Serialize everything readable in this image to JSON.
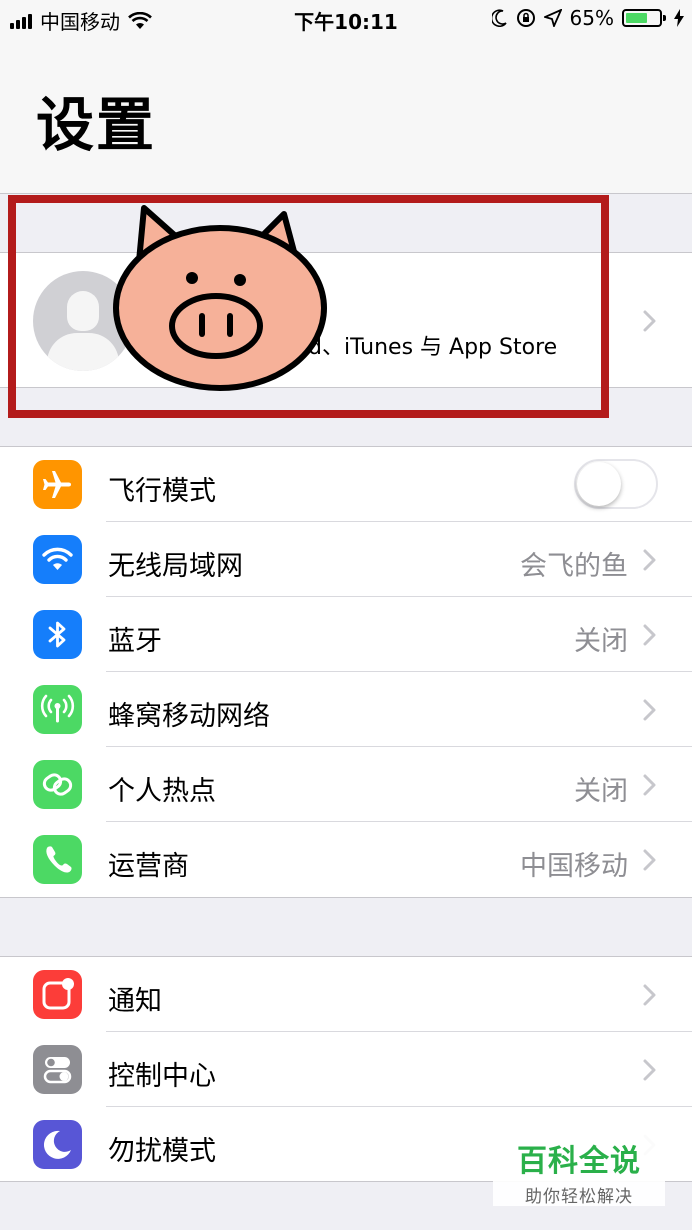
{
  "status_bar": {
    "carrier": "中国移动",
    "time": "下午10:11",
    "battery": "65%",
    "battery_level": 0.65,
    "icons": [
      "signal-icon",
      "wifi-icon",
      "moon-icon",
      "rotation-lock-icon",
      "location-icon",
      "battery-icon",
      "charging-icon"
    ]
  },
  "header": {
    "title": "设置"
  },
  "profile": {
    "subtitle": "d、iTunes 与 App Store",
    "icon": "avatar-placeholder-icon"
  },
  "group1": [
    {
      "label": "飞行模式",
      "value": "",
      "icon": "airplane-icon",
      "color": "#ff9500",
      "toggle": true,
      "toggle_on": false
    },
    {
      "label": "无线局域网",
      "value": "会飞的鱼",
      "icon": "wifi-icon",
      "color": "#157efb"
    },
    {
      "label": "蓝牙",
      "value": "关闭",
      "icon": "bluetooth-icon",
      "color": "#157efb"
    },
    {
      "label": "蜂窝移动网络",
      "value": "",
      "icon": "antenna-icon",
      "color": "#4cd964"
    },
    {
      "label": "个人热点",
      "value": "关闭",
      "icon": "hotspot-icon",
      "color": "#4cd964"
    },
    {
      "label": "运营商",
      "value": "中国移动",
      "icon": "phone-icon",
      "color": "#4cd964"
    }
  ],
  "group2": [
    {
      "label": "通知",
      "value": "",
      "icon": "notification-icon",
      "color": "#fc3d39"
    },
    {
      "label": "控制中心",
      "value": "",
      "icon": "switches-icon",
      "color": "#8e8e93"
    },
    {
      "label": "勿扰模式",
      "value": "",
      "icon": "moon-icon",
      "color": "#5856d6"
    }
  ],
  "overlay": {
    "highlight_color": "#b31b1b",
    "sticker": "pig-face-sticker"
  },
  "watermark": {
    "title": "百科全说",
    "subtitle": "助你轻松解决",
    "color": "#2ab04a"
  }
}
